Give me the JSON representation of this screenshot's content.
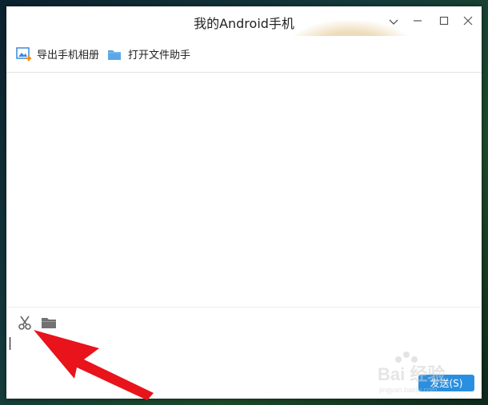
{
  "window": {
    "title": "我的Android手机"
  },
  "toolbar": {
    "export_album_label": "导出手机相册",
    "open_file_helper_label": "打开文件助手"
  },
  "input": {
    "send_label": "发送(S)"
  },
  "watermark": {
    "text": "Bai 经验",
    "sub": "jingyan.baidu.com"
  },
  "colors": {
    "accent": "#2a8fe0",
    "annotation_arrow": "#e8131b",
    "folder": "#5aa7e6"
  }
}
